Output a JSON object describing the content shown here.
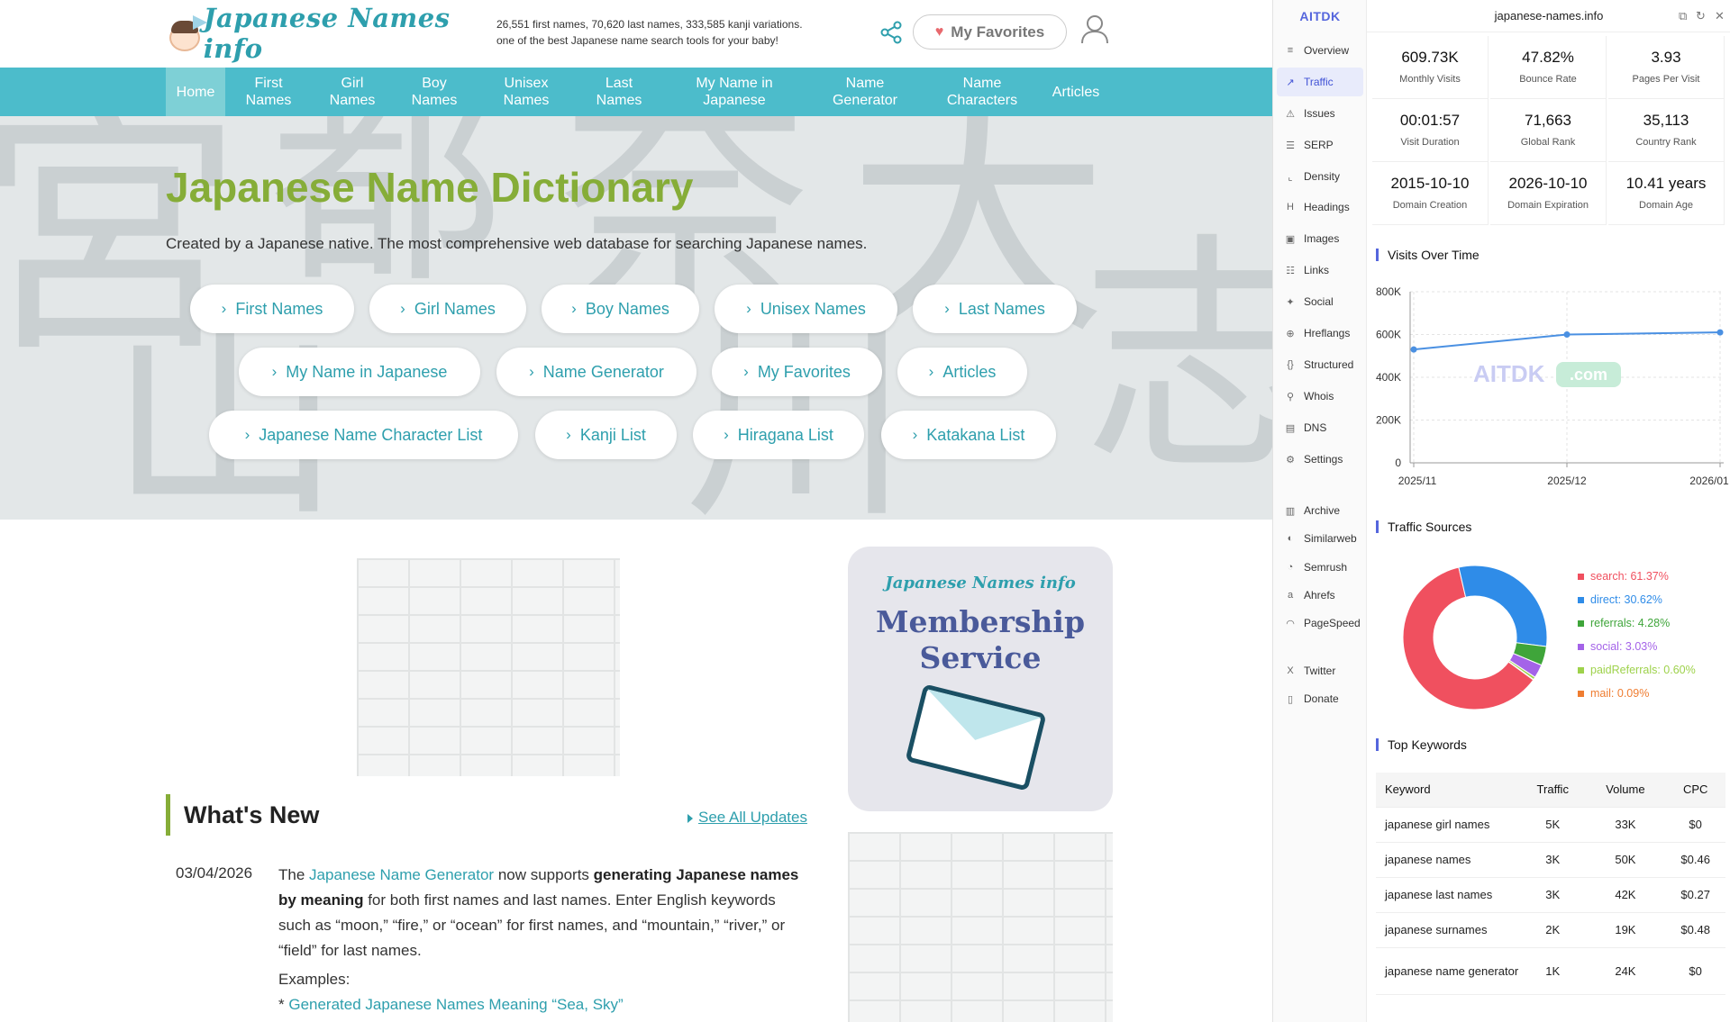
{
  "site": {
    "logo_text": "Japanese Names info",
    "tagline_1": "26,551 first names, 70,620 last names, 333,585 kanji variations.",
    "tagline_2": "one of the best Japanese name search tools for your baby!",
    "favorites_label": "My Favorites",
    "nav": [
      {
        "line1": "Home",
        "line2": ""
      },
      {
        "line1": "First",
        "line2": "Names"
      },
      {
        "line1": "Girl",
        "line2": "Names"
      },
      {
        "line1": "Boy",
        "line2": "Names"
      },
      {
        "line1": "Unisex",
        "line2": "Names"
      },
      {
        "line1": "Last",
        "line2": "Names"
      },
      {
        "line1": "My Name in",
        "line2": "Japanese"
      },
      {
        "line1": "Name",
        "line2": "Generator"
      },
      {
        "line1": "Name",
        "line2": "Characters"
      },
      {
        "line1": "Articles",
        "line2": ""
      }
    ],
    "hero_title": "Japanese Name Dictionary",
    "hero_subtitle": "Created by a Japanese native. The most comprehensive web database for searching Japanese names.",
    "pills": [
      "First Names",
      "Girl Names",
      "Boy Names",
      "Unisex Names",
      "Last Names",
      "My Name in Japanese",
      "Name Generator",
      "My Favorites",
      "Articles",
      "Japanese Name Character List",
      "Kanji List",
      "Hiragana List",
      "Katakana List"
    ],
    "membership_logo": "Japanese Names info",
    "membership_line1": "Membership",
    "membership_line2": "Service",
    "whats_new_title": "What's New",
    "see_all": "See All Updates",
    "news": {
      "date": "03/04/2026",
      "t1": "The ",
      "link": "Japanese Name Generator",
      "t2": " now supports ",
      "bold": "generating Japanese names by meaning",
      "t3": " for both first names and last names. Enter English keywords such as “moon,” “fire,” or “ocean” for first names, and “mountain,” “river,” or “field” for last names.",
      "examples": "Examples:",
      "example_bullet": "* ",
      "example_link": "Generated Japanese Names Meaning “Sea, Sky”"
    }
  },
  "ext": {
    "brand": "AITDK",
    "domain": "japanese-names.info",
    "sidebar": [
      {
        "label": "Overview",
        "icon": "≡"
      },
      {
        "label": "Traffic",
        "icon": "↗"
      },
      {
        "label": "Issues",
        "icon": "⚠"
      },
      {
        "label": "SERP",
        "icon": "☰"
      },
      {
        "label": "Density",
        "icon": "⌞"
      },
      {
        "label": "Headings",
        "icon": "H"
      },
      {
        "label": "Images",
        "icon": "▣"
      },
      {
        "label": "Links",
        "icon": "☷"
      },
      {
        "label": "Social",
        "icon": "✦"
      },
      {
        "label": "Hreflangs",
        "icon": "⊕"
      },
      {
        "label": "Structured",
        "icon": "{}"
      },
      {
        "label": "Whois",
        "icon": "⚲"
      },
      {
        "label": "DNS",
        "icon": "▤"
      },
      {
        "label": "Settings",
        "icon": "⚙"
      },
      {
        "label": "Archive",
        "icon": "▥"
      },
      {
        "label": "Similarweb",
        "icon": "◐"
      },
      {
        "label": "Semrush",
        "icon": "◔"
      },
      {
        "label": "Ahrefs",
        "icon": "a"
      },
      {
        "label": "PageSpeed",
        "icon": "◠"
      },
      {
        "label": "Twitter",
        "icon": "X"
      },
      {
        "label": "Donate",
        "icon": "▯"
      }
    ],
    "active_item": "Traffic",
    "stats": [
      {
        "value": "609.73K",
        "label": "Monthly Visits"
      },
      {
        "value": "47.82%",
        "label": "Bounce Rate"
      },
      {
        "value": "3.93",
        "label": "Pages Per Visit"
      },
      {
        "value": "00:01:57",
        "label": "Visit Duration"
      },
      {
        "value": "71,663",
        "label": "Global Rank"
      },
      {
        "value": "35,113",
        "label": "Country Rank"
      },
      {
        "value": "2015-10-10",
        "label": "Domain Creation"
      },
      {
        "value": "2026-10-10",
        "label": "Domain Expiration"
      },
      {
        "value": "10.41 years",
        "label": "Domain Age"
      }
    ],
    "visits_title": "Visits Over Time",
    "watermark": "AITDK",
    "watermark_suffix": ".com",
    "sources_title": "Traffic Sources",
    "keywords_title": "Top Keywords",
    "kw_headers": [
      "Keyword",
      "Traffic",
      "Volume",
      "CPC"
    ],
    "keywords": [
      {
        "keyword": "japanese girl names",
        "traffic": "5K",
        "volume": "33K",
        "cpc": "$0"
      },
      {
        "keyword": "japanese names",
        "traffic": "3K",
        "volume": "50K",
        "cpc": "$0.46"
      },
      {
        "keyword": "japanese last names",
        "traffic": "3K",
        "volume": "42K",
        "cpc": "$0.27"
      },
      {
        "keyword": "japanese surnames",
        "traffic": "2K",
        "volume": "19K",
        "cpc": "$0.48"
      },
      {
        "keyword": "japanese name generator",
        "traffic": "1K",
        "volume": "24K",
        "cpc": "$0"
      }
    ],
    "colors": {
      "accent": "#5566dd",
      "site_teal": "#4cbccb",
      "site_green": "#86ad38"
    }
  },
  "chart_data": [
    {
      "type": "line",
      "x": [
        "2025/11",
        "2025/12",
        "2026/01"
      ],
      "y_ticks": [
        "0",
        "200K",
        "400K",
        "600K",
        "800K"
      ],
      "ylim": [
        0,
        800000
      ],
      "series": [
        {
          "values": [
            530000,
            600000,
            610000
          ],
          "color": "#4a90e2"
        }
      ],
      "grid": true
    },
    {
      "type": "pie",
      "donut": true,
      "slices": [
        {
          "name": "search",
          "label": "search: 61.37%",
          "value": 61.37,
          "color": "#f0505f"
        },
        {
          "name": "direct",
          "label": "direct: 30.62%",
          "value": 30.62,
          "color": "#2f8ce8"
        },
        {
          "name": "referrals",
          "label": "referrals: 4.28%",
          "value": 4.28,
          "color": "#3fa53a"
        },
        {
          "name": "social",
          "label": "social: 3.03%",
          "value": 3.03,
          "color": "#a463e8"
        },
        {
          "name": "paidReferrals",
          "label": "paidReferrals: 0.60%",
          "value": 0.6,
          "color": "#9ed24b"
        },
        {
          "name": "mail",
          "label": "mail: 0.09%",
          "value": 0.09,
          "color": "#ef7d31"
        }
      ],
      "legend": "right"
    }
  ]
}
